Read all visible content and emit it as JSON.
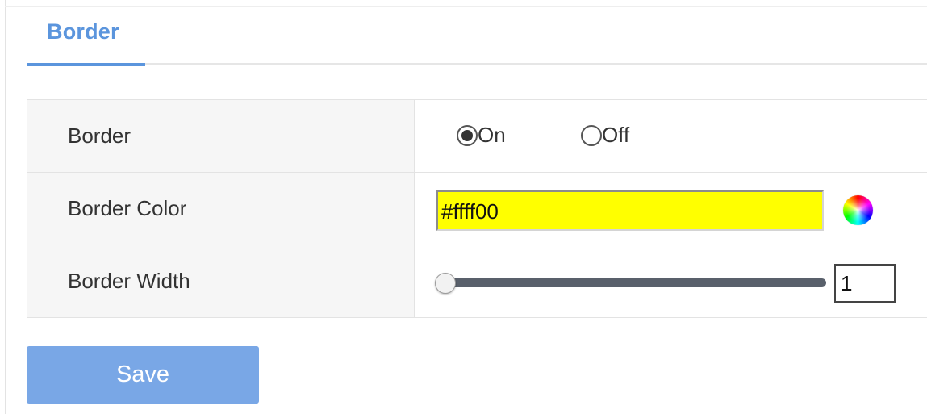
{
  "tabs": [
    {
      "label": "Border",
      "active": true
    }
  ],
  "settings": {
    "border": {
      "label": "Border",
      "options": [
        {
          "label": "On",
          "selected": true
        },
        {
          "label": "Off",
          "selected": false
        }
      ]
    },
    "border_color": {
      "label": "Border Color",
      "value": "#ffff00",
      "display_value": "#ffff00",
      "picker_icon": "color-wheel-icon"
    },
    "border_width": {
      "label": "Border Width",
      "value": "1",
      "slider_level": 0.0
    }
  },
  "actions": {
    "save_label": "Save"
  },
  "colors": {
    "accent": "#5b95dd",
    "save_button": "#79a7e6",
    "color_field": "#ffff00",
    "label_cell_bg": "#f6f6f6"
  }
}
